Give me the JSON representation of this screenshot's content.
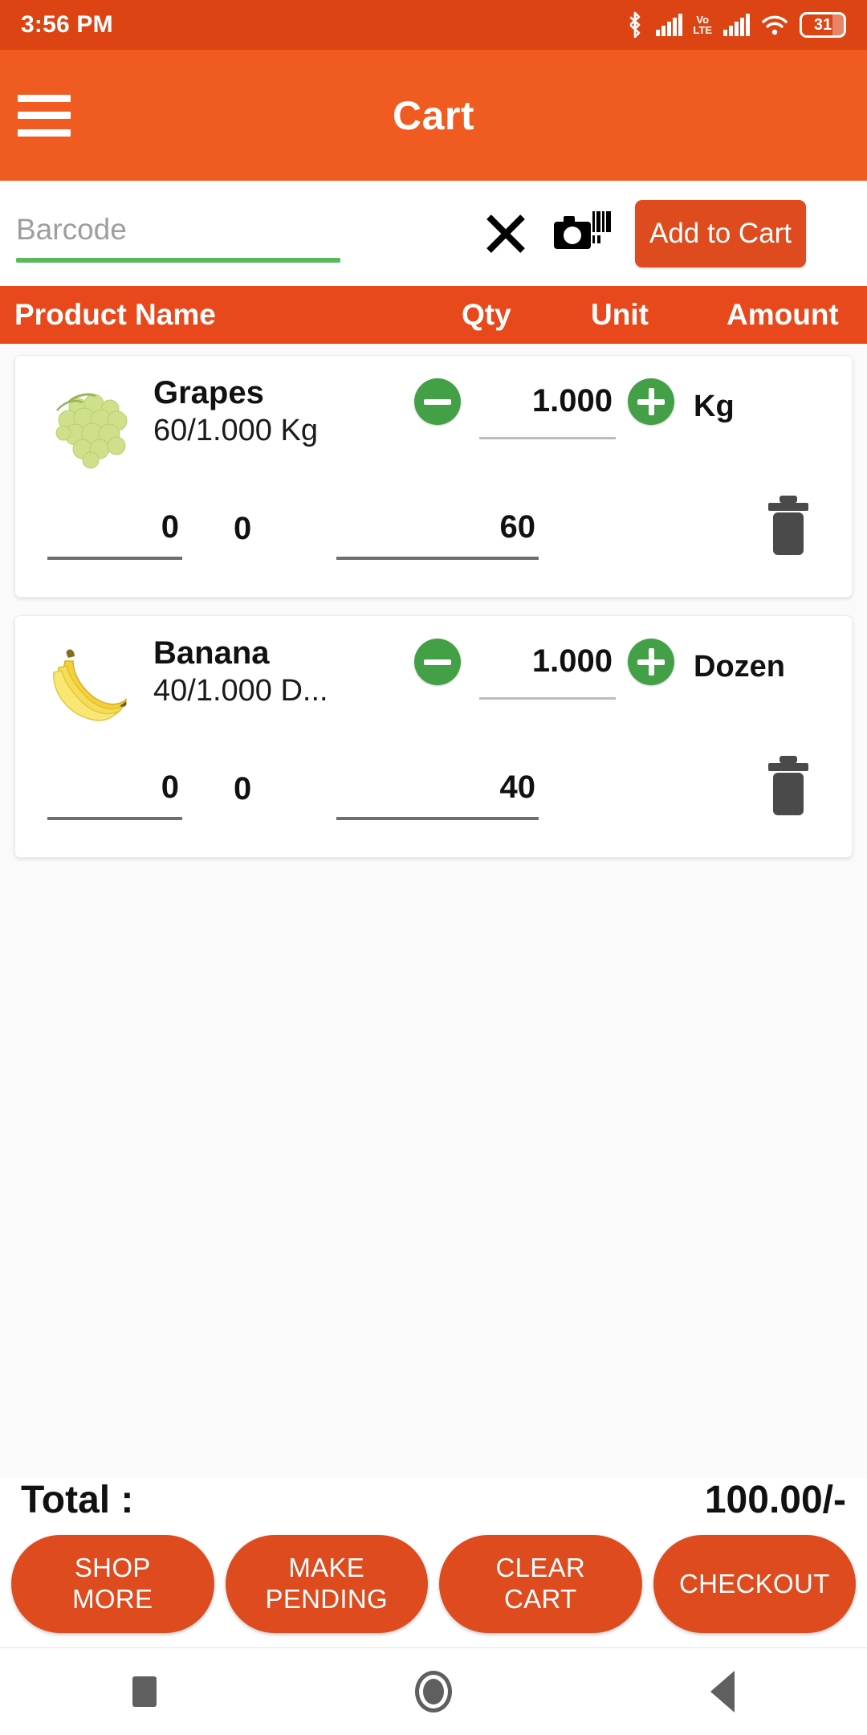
{
  "status_bar": {
    "time": "3:56 PM",
    "battery_level": "31",
    "icons": [
      "bluetooth-icon",
      "signal-icon",
      "volte-icon",
      "signal-icon",
      "wifi-icon",
      "battery-icon"
    ],
    "volte_top": "Vo",
    "volte_bottom": "LTE",
    "background": "#dc4414"
  },
  "app_bar": {
    "title": "Cart",
    "menu_icon": "hamburger-icon",
    "background": "#ef5b20"
  },
  "barcode": {
    "placeholder": "Barcode",
    "value": "",
    "underline_color": "#5cb85c",
    "clear_icon": "close-icon",
    "scan_icon": "barcode-scanner-icon",
    "add_button_label": "Add to Cart",
    "add_button_color": "#dd4b1e"
  },
  "table_header": {
    "product_name": "Product Name",
    "qty": "Qty",
    "unit": "Unit",
    "amount": "Amount",
    "background": "#e8491c"
  },
  "cart_items": [
    {
      "name": "Grapes",
      "price_per_unit": "60/1.000 Kg",
      "image": "grapes-thumbnail",
      "decrement_label": "minus-icon",
      "increment_label": "plus-icon",
      "quantity": "1.000",
      "unit": "Kg",
      "discount": "0",
      "extra": "0",
      "amount": "60",
      "delete_icon": "trash-icon"
    },
    {
      "name": "Banana",
      "price_per_unit": "40/1.000 D...",
      "image": "banana-thumbnail",
      "decrement_label": "minus-icon",
      "increment_label": "plus-icon",
      "quantity": "1.000",
      "unit": "Dozen",
      "discount": "0",
      "extra": "0",
      "amount": "40",
      "delete_icon": "trash-icon"
    }
  ],
  "totals": {
    "label": "Total :",
    "value": "100.00/-"
  },
  "actions": [
    {
      "label": "SHOP\nMORE"
    },
    {
      "label": "MAKE\nPENDING"
    },
    {
      "label": "CLEAR\nCART"
    },
    {
      "label": "CHECKOUT"
    }
  ],
  "nav_bar": {
    "recents": "recents-square-icon",
    "home": "home-circle-icon",
    "back": "back-triangle-icon"
  },
  "theme": {
    "primary": "#ef5b20",
    "primary_dark": "#dc4414",
    "accent_green": "#43a047",
    "button_orange": "#dd4b1e"
  }
}
